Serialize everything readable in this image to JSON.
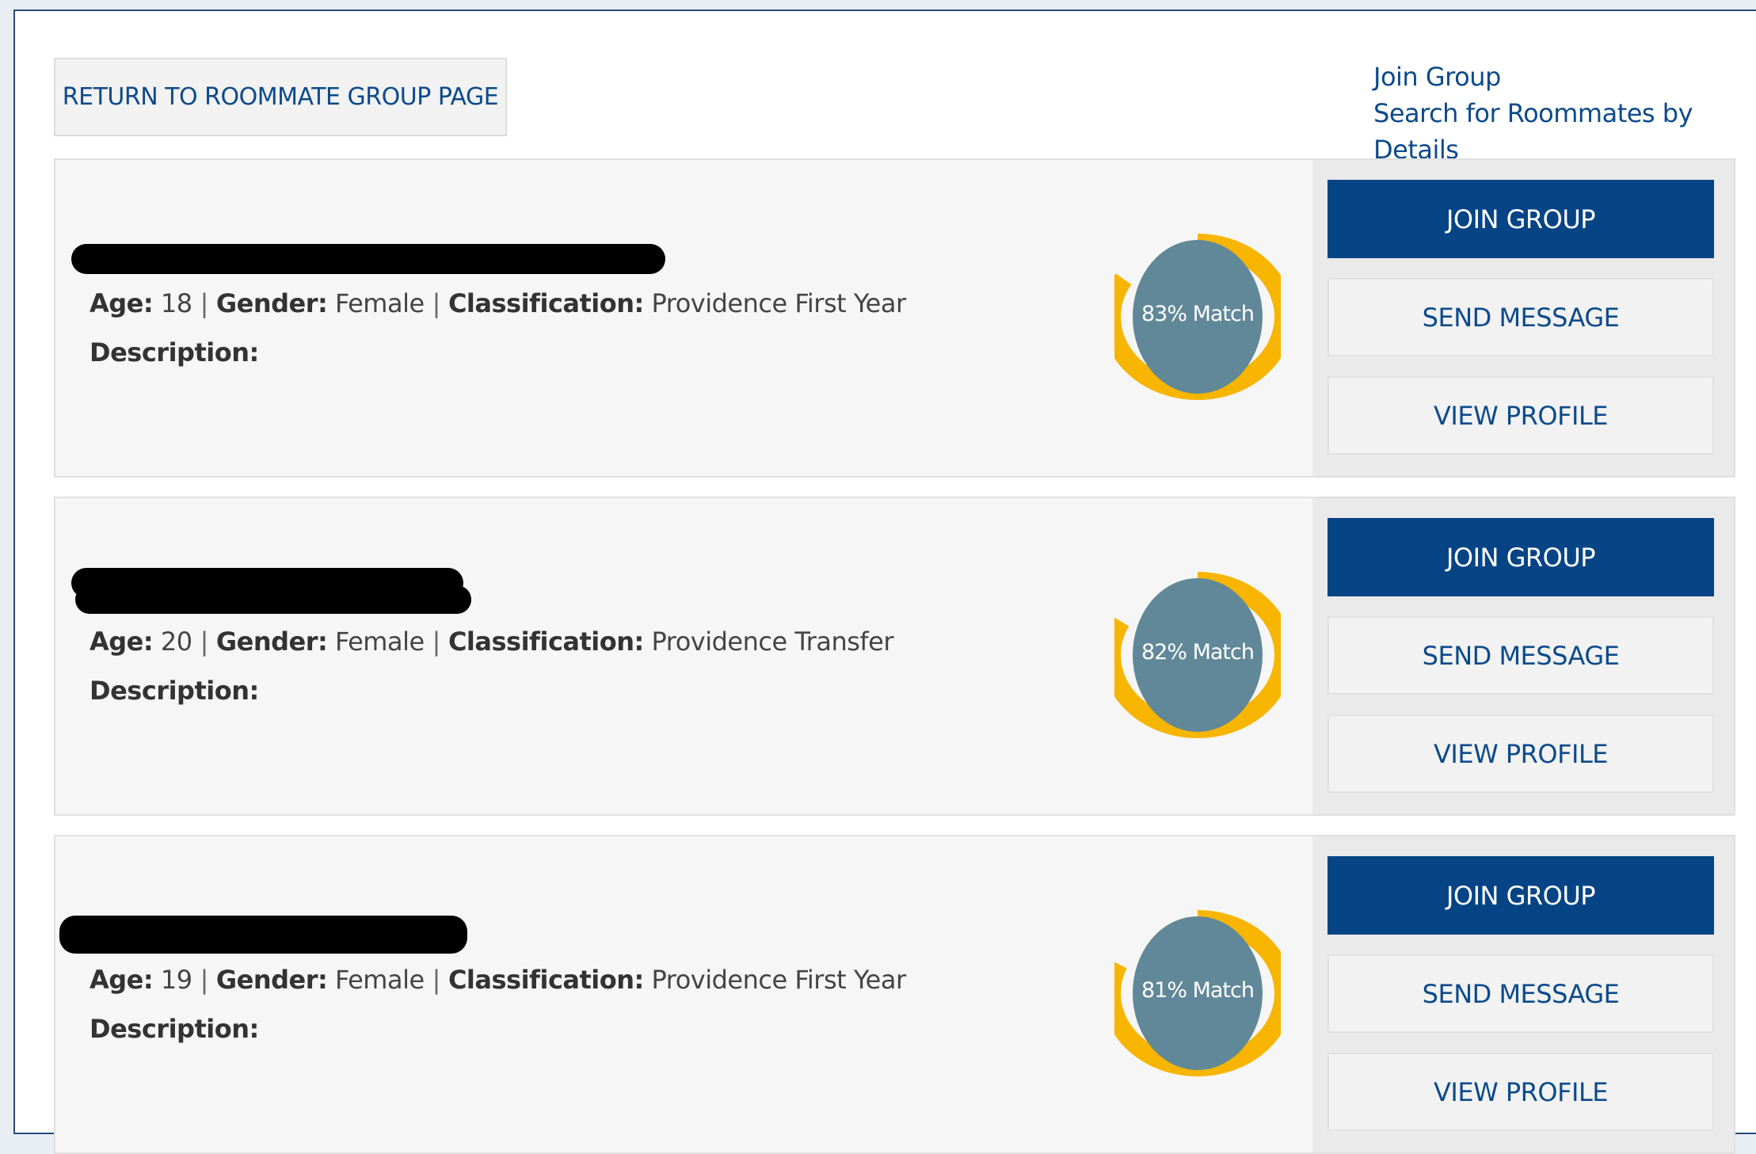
{
  "nav": {
    "return_label": "RETURN TO ROOMMATE GROUP PAGE",
    "join_group_link": "Join Group",
    "search_link": "Search for Roommates by Details"
  },
  "labels": {
    "age": "Age:",
    "gender": "Gender:",
    "classification": "Classification:",
    "description": "Description:",
    "join_group": "JOIN GROUP",
    "send_message": "SEND MESSAGE",
    "view_profile": "VIEW PROFILE"
  },
  "colors": {
    "primary": "#064486",
    "ring": "#f7b500",
    "ring_inner": "#618899",
    "link": "#0c4a8c"
  },
  "matches": [
    {
      "name_redacted": true,
      "age": "18",
      "gender": "Female",
      "classification": "Providence First Year",
      "description": "",
      "match_label": "83% Match",
      "match_fraction": 0.83
    },
    {
      "name_redacted": true,
      "age": "20",
      "gender": "Female",
      "classification": "Providence Transfer",
      "description": "",
      "match_label": "82% Match",
      "match_fraction": 0.82
    },
    {
      "name_redacted": true,
      "age": "19",
      "gender": "Female",
      "classification": "Providence First Year",
      "description": "",
      "match_label": "81% Match",
      "match_fraction": 0.81
    }
  ]
}
